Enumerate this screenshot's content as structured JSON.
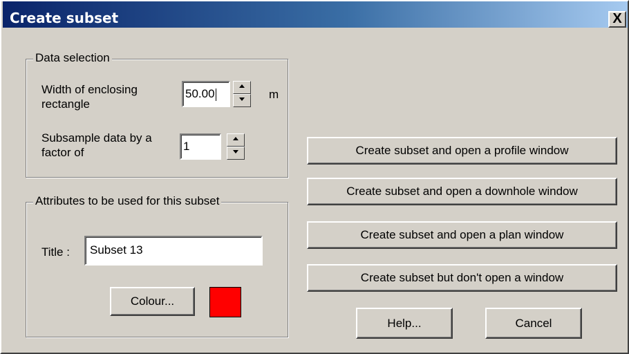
{
  "window": {
    "title": "Create subset",
    "close_glyph": "X"
  },
  "data_selection": {
    "legend": "Data selection",
    "width_label_line1": "Width of enclosing",
    "width_label_line2": "rectangle",
    "width_value": "50.00",
    "width_unit": "m",
    "subsample_label_line1": "Subsample data by a",
    "subsample_label_line2": "factor of",
    "subsample_value": "1"
  },
  "attributes": {
    "legend": "Attributes to be used for this subset",
    "title_label": "Title :",
    "title_value": "Subset 13",
    "colour_button": "Colour...",
    "colour_value": "#ff0000"
  },
  "actions": {
    "profile": "Create subset and open a profile window",
    "downhole": "Create subset and open a downhole window",
    "plan": "Create subset and open a plan window",
    "no_window": "Create subset but don't open a window",
    "help": "Help...",
    "cancel": "Cancel"
  },
  "icons": {
    "spin_up": "triangle-up-icon",
    "spin_down": "triangle-down-icon"
  }
}
